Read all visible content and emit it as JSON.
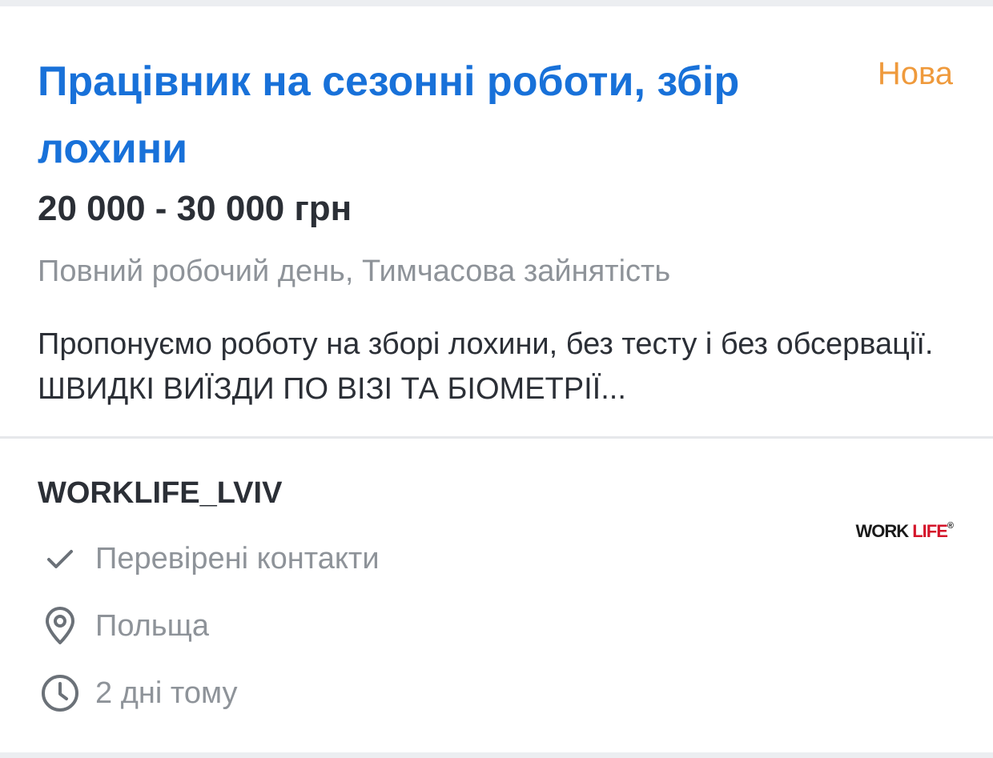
{
  "vacancy": {
    "title": "Працівник на сезонні роботи, збір лохини",
    "badge": "Нова",
    "salary": "20 000 - 30 000 грн",
    "schedule": "Повний робочий день, Тимчасова зайнятість",
    "description": "Пропонуємо роботу на зборі лохини, без тесту і без обсервації. ШВИДКІ ВИЇЗДИ ПО ВІЗІ ТА БІОМЕТРІЇ..."
  },
  "company": {
    "name": "WORKLIFE_LVIV",
    "logo": {
      "part1": "WORK ",
      "part2": "LIFE",
      "mark": "®"
    }
  },
  "meta": {
    "verified": {
      "icon": "check-icon",
      "text": "Перевірені контакти"
    },
    "location": {
      "icon": "location-pin-icon",
      "text": "Польща"
    },
    "posted": {
      "icon": "clock-icon",
      "text": "2 дні тому"
    }
  },
  "colors": {
    "title": "#1871d9",
    "badge": "#ef9a3c",
    "muted": "#8e9399",
    "text": "#2b2f36",
    "logo_red": "#d4152a"
  }
}
